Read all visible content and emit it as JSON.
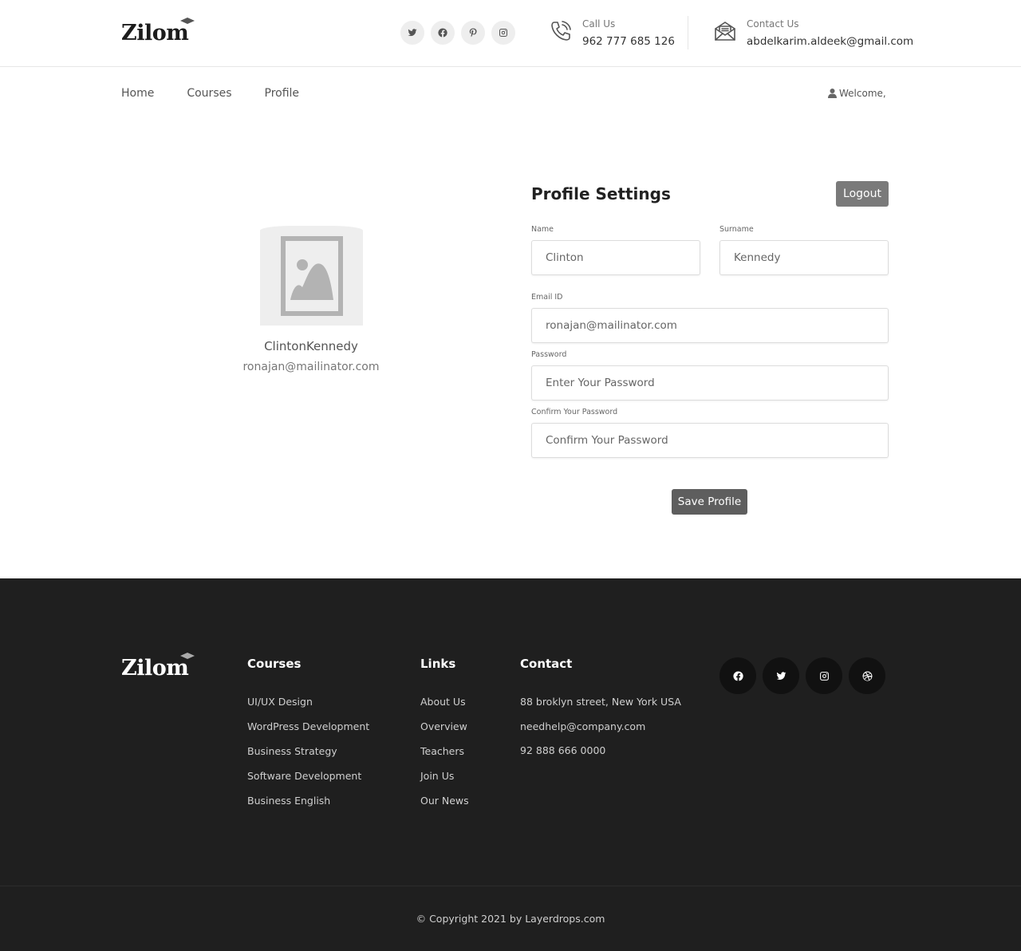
{
  "brand": {
    "name": "Zilom"
  },
  "header": {
    "social": [
      "twitter-icon",
      "facebook-icon",
      "pinterest-icon",
      "instagram-icon"
    ],
    "call": {
      "label": "Call Us",
      "value": "962 777 685 126"
    },
    "contact": {
      "label": "Contact Us",
      "value": "abdelkarim.aldeek@gmail.com"
    }
  },
  "nav": {
    "items": [
      "Home",
      "Courses",
      "Profile"
    ],
    "welcome": "Welcome,"
  },
  "profile": {
    "display_name": "ClintonKennedy",
    "email": "ronajan@mailinator.com"
  },
  "settings": {
    "title": "Profile Settings",
    "logout": "Logout",
    "name_label": "Name",
    "name_value": "Clinton",
    "surname_label": "Surname",
    "surname_value": "Kennedy",
    "email_label": "Email ID",
    "email_value": "ronajan@mailinator.com",
    "password_label": "Password",
    "password_placeholder": "Enter Your Password",
    "confirm_label": "Confirm Your Password",
    "confirm_placeholder": "Confirm Your Password",
    "save": "Save Profile"
  },
  "footer": {
    "courses": {
      "title": "Courses",
      "items": [
        "UI/UX Design",
        "WordPress Development",
        "Business Strategy",
        "Software Development",
        "Business English"
      ]
    },
    "links": {
      "title": "Links",
      "items": [
        "About Us",
        "Overview",
        "Teachers",
        "Join Us",
        "Our News"
      ]
    },
    "contact": {
      "title": "Contact",
      "items": [
        "88 broklyn street, New York USA",
        "needhelp@company.com",
        "92 888 666 0000"
      ]
    },
    "social": [
      "facebook-icon",
      "twitter-icon",
      "instagram-icon",
      "dribbble-icon"
    ],
    "copyright": "© Copyright 2021 by Layerdrops.com"
  },
  "colors": {
    "footer_bg": "#1f1f1f",
    "button_gray": "#7a7a7a",
    "save_button": "#5e5e5e"
  }
}
